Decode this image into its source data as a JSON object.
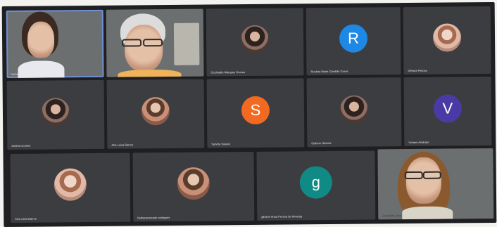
{
  "participants": {
    "t1": {
      "name": "hernandes",
      "mic": ""
    },
    "t2": {
      "name": "",
      "mic": ""
    },
    "t3": {
      "name": "Clodoaldo Marques Gomes",
      "mic": ""
    },
    "t4": {
      "name": "Rosária Maria Cândida Torres",
      "mic": "",
      "initial": "R"
    },
    "t5": {
      "name": "Débora Feitosa",
      "mic": ""
    },
    "t6": {
      "name": "Andrea Gomes",
      "mic": ""
    },
    "t7": {
      "name": "Ana Luiza Barros",
      "mic": ""
    },
    "t8": {
      "name": "Sandra Soares",
      "mic": "",
      "initial": "S"
    },
    "t9": {
      "name": "Gislene Oliveira",
      "mic": ""
    },
    "t10": {
      "name": "Viviane Andrade",
      "mic": "",
      "initial": "V"
    },
    "t11": {
      "name": "Ana Lúcia Barros",
      "mic": ""
    },
    "t12": {
      "name": "barbaraconrado rodrigues",
      "mic": ""
    },
    "t13": {
      "name": "gilvane Anna Pereira de Almeida",
      "mic": "",
      "initial": "g"
    },
    "t14": {
      "name": "Carmelita Saez",
      "mic": ""
    }
  },
  "colors": {
    "tile_bg": "#3c3d40",
    "avatar_R": "#1e88e5",
    "avatar_S": "#f26a22",
    "avatar_V": "#4a3aa6",
    "avatar_g": "#0f8a84"
  }
}
